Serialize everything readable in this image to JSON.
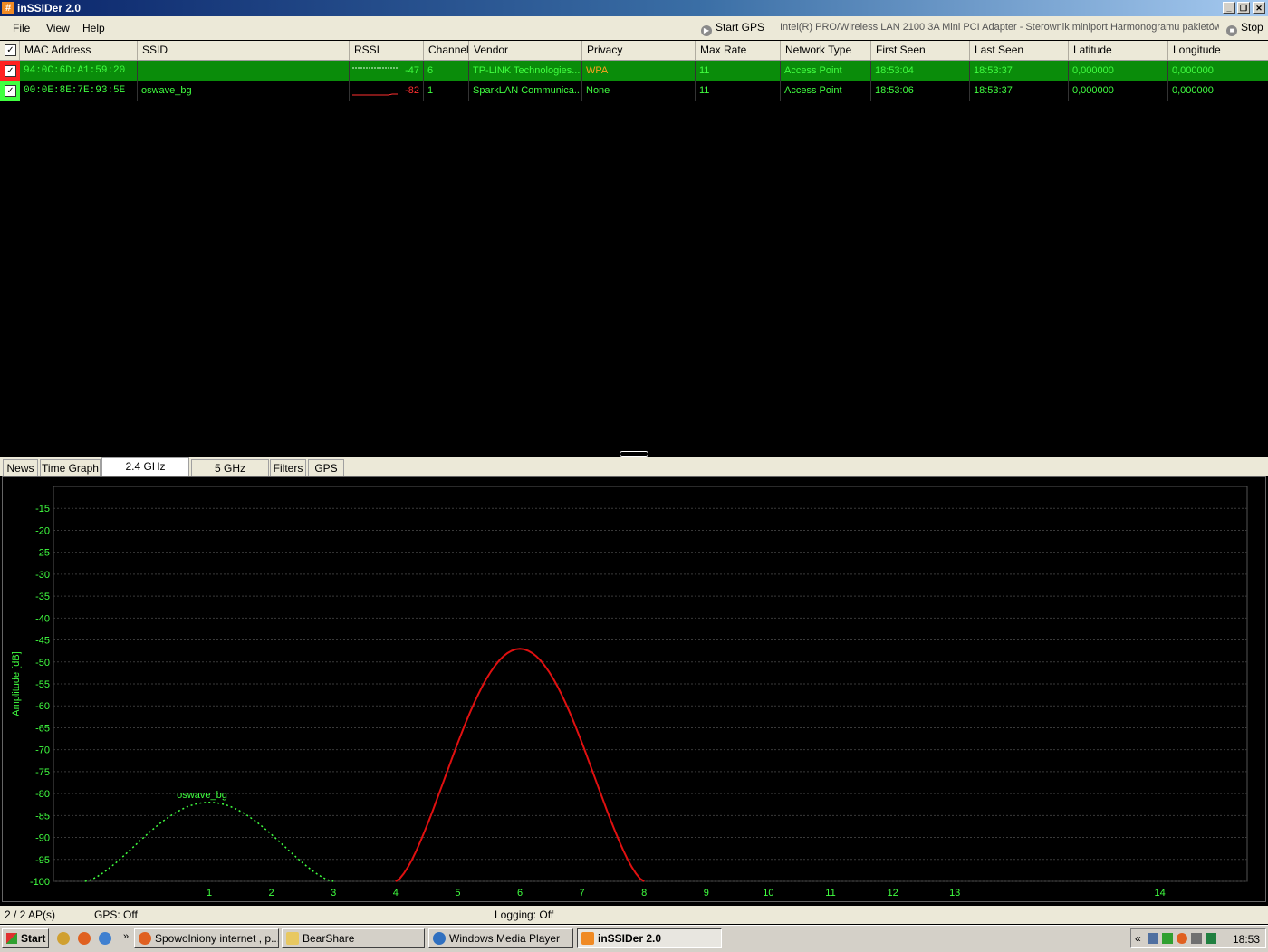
{
  "window": {
    "title": "inSSIDer 2.0",
    "app_icon": "#"
  },
  "menu": [
    "File",
    "View",
    "Help"
  ],
  "toolbar": {
    "start_gps": "Start GPS",
    "adapter": "Intel(R) PRO/Wireless LAN 2100 3A Mini PCI Adapter - Sterownik miniport Harmonogramu pakietów",
    "stop": "Stop"
  },
  "table": {
    "columns": [
      "MAC Address",
      "SSID",
      "RSSI",
      "Channel",
      "Vendor",
      "Privacy",
      "Max Rate",
      "Network Type",
      "First Seen",
      "Last Seen",
      "Latitude",
      "Longitude"
    ],
    "rows": [
      {
        "mac": "94:0C:6D:A1:59:20",
        "ssid": "",
        "rssi": "-47",
        "channel": "6",
        "vendor": "TP-LINK Technologies...",
        "privacy": "WPA",
        "max_rate": "11",
        "network_type": "Access Point",
        "first_seen": "18:53:04",
        "last_seen": "18:53:37",
        "latitude": "0,000000",
        "longitude": "0,000000",
        "color": "#ff2020",
        "selected": true
      },
      {
        "mac": "00:0E:8E:7E:93:5E",
        "ssid": "oswave_bg",
        "rssi": "-82",
        "channel": "1",
        "vendor": "SparkLAN Communica...",
        "privacy": "None",
        "max_rate": "11",
        "network_type": "Access Point",
        "first_seen": "18:53:06",
        "last_seen": "18:53:37",
        "latitude": "0,000000",
        "longitude": "0,000000",
        "color": "#40ff40",
        "selected": false
      }
    ]
  },
  "tabs": [
    "News",
    "Time Graph",
    "2.4 GHz Channels",
    "5 GHz Channels",
    "Filters",
    "GPS"
  ],
  "active_tab": "2.4 GHz Channels",
  "chart_data": {
    "type": "line",
    "title": "",
    "xlabel": "",
    "ylabel": "Amplitude [dB]",
    "ylim": [
      -100,
      -10
    ],
    "yticks": [
      -15,
      -20,
      -25,
      -30,
      -35,
      -40,
      -45,
      -50,
      -55,
      -60,
      -65,
      -70,
      -75,
      -80,
      -85,
      -90,
      -95,
      -100
    ],
    "xticks": [
      "1",
      "2",
      "3",
      "4",
      "5",
      "6",
      "7",
      "8",
      "9",
      "10",
      "11",
      "12",
      "13",
      "14"
    ],
    "grid": true,
    "series": [
      {
        "name": "oswave_bg",
        "channel": 1,
        "peak": -82,
        "color": "#40ff40",
        "style": "dotted",
        "label_shown": true
      },
      {
        "name": "",
        "channel": 6,
        "peak": -47,
        "color": "#e01010",
        "style": "solid",
        "label_shown": false
      }
    ]
  },
  "status": {
    "aps": "2 / 2 AP(s)",
    "gps": "GPS: Off",
    "logging": "Logging: Off"
  },
  "taskbar": {
    "start": "Start",
    "items": [
      "Spowolniony internet , p...",
      "BearShare",
      "Windows Media Player",
      "inSSIDer 2.0"
    ],
    "clock": "18:53",
    "tray_chevron": "«",
    "ql_chevron": "»"
  }
}
